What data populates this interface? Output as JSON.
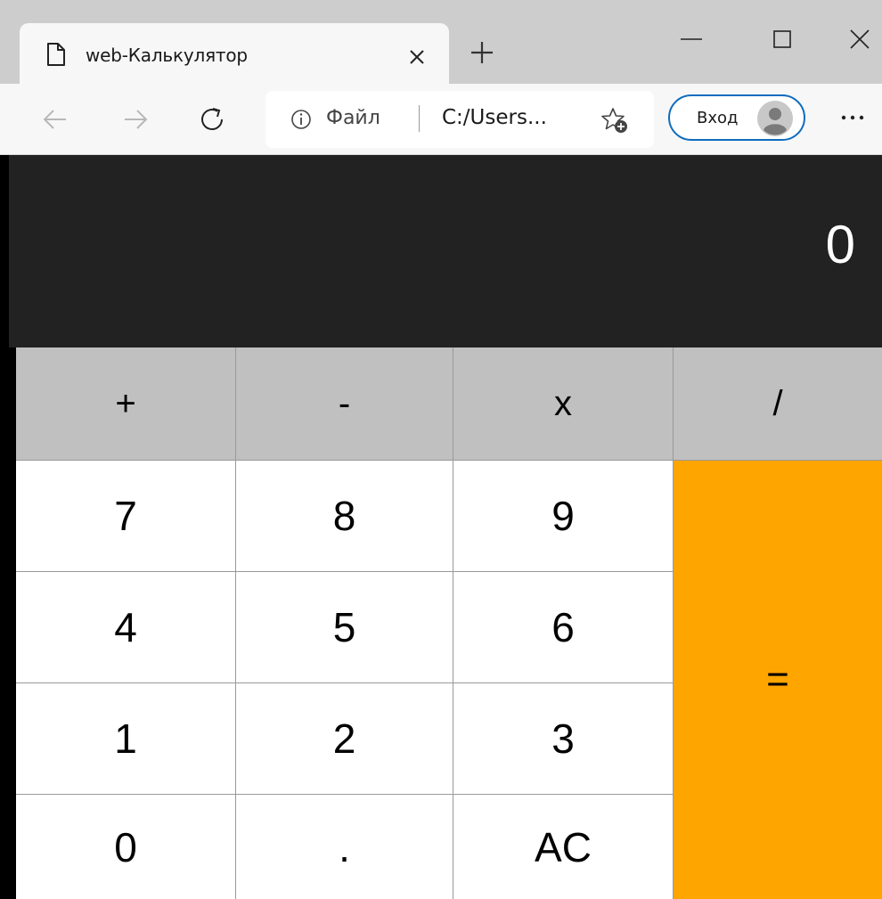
{
  "browser": {
    "tab_title": "web-Калькулятор",
    "address_scheme": "Файл",
    "address_url": "C:/Users...",
    "signin_label": "Вход"
  },
  "icons": {
    "tab": [
      "page-icon",
      "close-icon"
    ],
    "tabstrip": [
      "new-tab-icon"
    ],
    "window": [
      "minimize-icon",
      "maximize-icon",
      "close-icon"
    ],
    "toolbar": [
      "back-arrow-icon",
      "forward-arrow-icon",
      "reload-icon",
      "info-icon",
      "add-favorite-icon",
      "avatar",
      "more-icon"
    ]
  },
  "calculator": {
    "display_value": "0",
    "operators": [
      "+",
      "-",
      "x",
      "/"
    ],
    "digits": {
      "row1": [
        "7",
        "8",
        "9"
      ],
      "row2": [
        "4",
        "5",
        "6"
      ],
      "row3": [
        "1",
        "2",
        "3"
      ],
      "row4": [
        "0",
        ".",
        "AC"
      ]
    },
    "equals": "="
  },
  "colors": {
    "display_bg": "#222222",
    "operator_bg": "#c0c0c0",
    "digit_bg": "#ffffff",
    "equals_bg": "#ffa500",
    "signin_border": "#0f6cbd"
  }
}
